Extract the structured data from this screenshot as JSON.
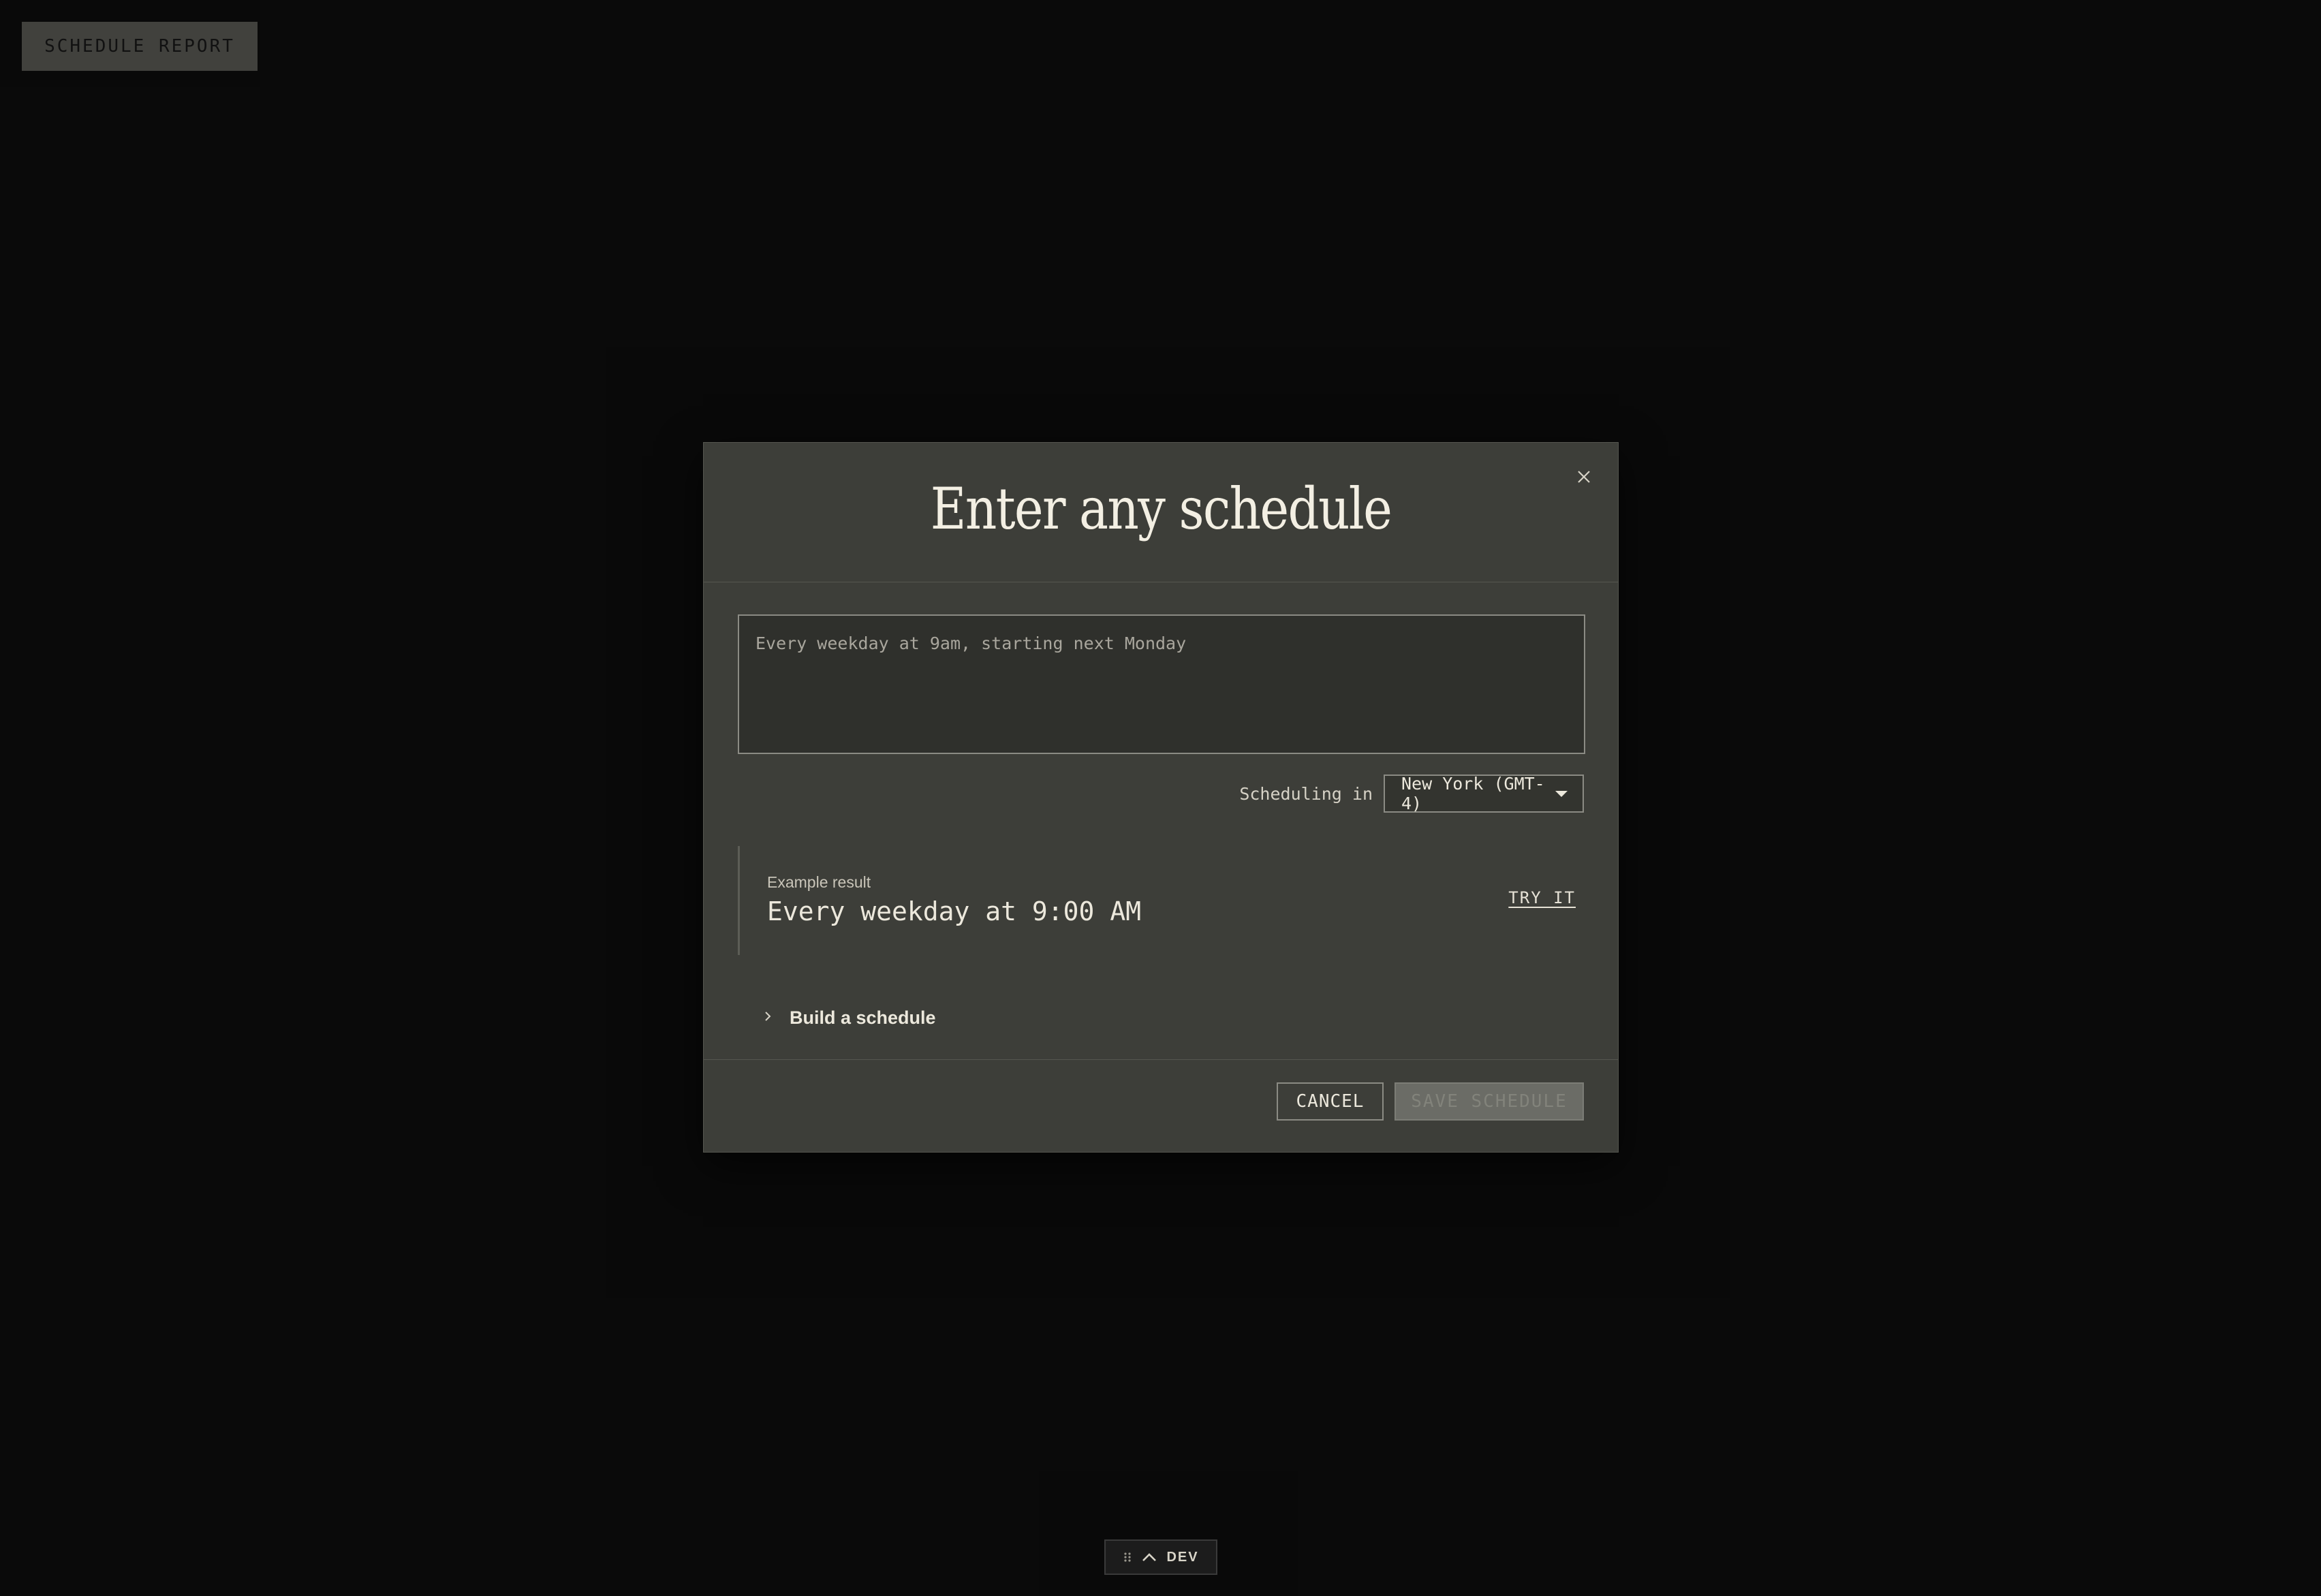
{
  "background": {
    "schedule_report_label": "SCHEDULE REPORT"
  },
  "modal": {
    "title": "Enter any schedule",
    "close_icon": "close-icon",
    "input": {
      "value": "",
      "placeholder": "Every weekday at 9am, starting next Monday"
    },
    "timezone": {
      "label": "Scheduling in",
      "selected": "New York (GMT-4)"
    },
    "example": {
      "label": "Example result",
      "value": "Every weekday at 9:00 AM",
      "try_label": "TRY IT"
    },
    "build": {
      "label": "Build a schedule",
      "icon": "chevron-right-icon"
    },
    "footer": {
      "cancel_label": "CANCEL",
      "save_label": "SAVE SCHEDULE"
    }
  },
  "dev_toolbar": {
    "label": "DEV",
    "grip_icon": "grip-icon",
    "toggle_icon": "chevron-up-icon"
  },
  "colors": {
    "page_bg": "#0b0b0b",
    "modal_bg": "#3d3e39",
    "title_text": "#f3efe3",
    "border": "#8b8b84",
    "disabled_button": "#6b6c66"
  }
}
